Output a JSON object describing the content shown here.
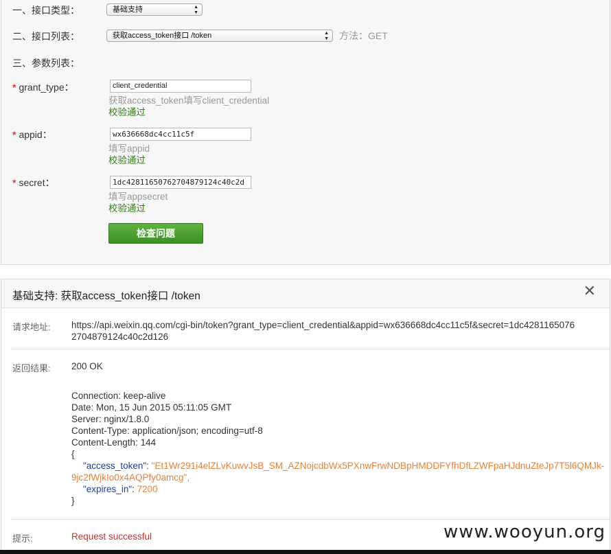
{
  "form": {
    "api_type_label": "一、接口类型：",
    "api_type_value": "基础支持",
    "api_list_label": "二、接口列表：",
    "api_list_value": "获取access_token接口 /token",
    "method": "方法：GET",
    "params_label": "三、参数列表：",
    "params": [
      {
        "name": "grant_type：",
        "value": "client_credential",
        "hint": "获取access_token填写client_credential",
        "status": "校验通过"
      },
      {
        "name": "appid：",
        "value": "wx636668dc4cc11c5f",
        "hint": "填写appid",
        "status": "校验通过"
      },
      {
        "name": "secret：",
        "value": "1dc42811650762704879124c40c2d",
        "hint": "填写appsecret",
        "status": "校验通过"
      }
    ],
    "required_mark": "*",
    "check_button": "检查问题"
  },
  "result": {
    "title": "基础支持: 获取access_token接口 /token",
    "close": "✕",
    "url_label": "请求地址:",
    "url_line1": "https://api.weixin.qq.com/cgi-bin/token?grant_type=client_credential&appid=wx636668dc4cc11c5f&secret=1dc4281165076",
    "url_line2": "2704879124c40c2d126",
    "return_label": "返回结果:",
    "status_line": "200 OK",
    "headers": [
      "Connection: keep-alive",
      "Date: Mon, 15 Jun 2015 05:11:05 GMT",
      "Server: nginx/1.8.0",
      "Content-Type: application/json; encoding=utf-8",
      "Content-Length: 144"
    ],
    "json_open": "{",
    "json_key1": "\"access_token\"",
    "json_colon": ": ",
    "json_val1_line1": "\"Et1Wr291i4elZLvKuwvJsB_SM_AZNojcdbWx5PXnwFrwNDBpHMDDFYfhDfLZWFpaHJdnuZteJp7T5l6QMJk-",
    "json_val1_line2": "9jc2fWjkIo0x4AQPfy0amcg\",",
    "json_key2": "\"expires_in\"",
    "json_val2": "7200",
    "json_close": "}",
    "tip_label": "提示:",
    "tip_text": "Request successful"
  },
  "watermark": "www.wooyun.org",
  "colors": {
    "button_green": "#4fa233",
    "success_red": "#c9302c",
    "json_key": "#1f3d99",
    "json_value": "#e5813a"
  }
}
